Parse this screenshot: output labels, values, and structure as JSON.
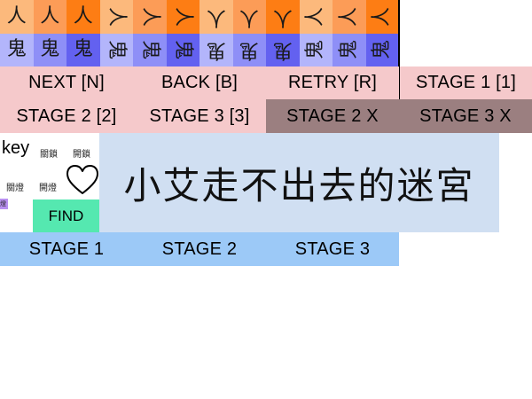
{
  "tile_rows": [
    {
      "glyphs": [
        "人",
        "人",
        "人",
        "人",
        "人",
        "人",
        "人",
        "人",
        "人",
        "人",
        "人",
        "人"
      ],
      "rotation_deg": [
        0,
        0,
        0,
        90,
        90,
        90,
        180,
        180,
        180,
        270,
        270,
        270
      ],
      "colors": [
        "#fcb97c",
        "#fc9c57",
        "#fd7d14",
        "#fcb97c",
        "#fc9c57",
        "#fd7d14",
        "#fcb97c",
        "#fc9c57",
        "#fd7d14",
        "#fcb97c",
        "#fc9c57",
        "#fd7d14"
      ]
    },
    {
      "glyphs": [
        "鬼",
        "鬼",
        "鬼",
        "鬼",
        "鬼",
        "鬼",
        "鬼",
        "鬼",
        "鬼",
        "鬼",
        "鬼",
        "鬼"
      ],
      "rotation_deg": [
        0,
        0,
        0,
        90,
        90,
        90,
        180,
        180,
        180,
        270,
        270,
        270
      ],
      "colors": [
        "#b3b5fb",
        "#8e8ff7",
        "#6361f0",
        "#b3b5fb",
        "#8e8ff7",
        "#6361f0",
        "#b3b5fb",
        "#8e8ff7",
        "#6361f0",
        "#b3b5fb",
        "#8e8ff7",
        "#6361f0"
      ]
    }
  ],
  "controls": {
    "next": "NEXT [N]",
    "back": "BACK [B]",
    "retry": "RETRY [R]",
    "stage1_key": "STAGE 1 [1]",
    "stage2_key": "STAGE 2 [2]",
    "stage3_key": "STAGE 3 [3]",
    "stage2_x": "STAGE 2 X",
    "stage3_x": "STAGE 3 X"
  },
  "panel": {
    "key_label": "key",
    "lock_a": "關鎖",
    "lock_b": "開鎖",
    "light_a": "關燈",
    "light_b": "開燈",
    "find_label": "FIND",
    "purple_mark": "燈",
    "heart_icon": "heart-icon"
  },
  "title": "小艾走不出去的迷宮",
  "stage_tabs": [
    "STAGE 1",
    "STAGE 2",
    "STAGE 3"
  ],
  "colors": {
    "pink": "#f5c9cb",
    "mauve": "#9b7f80",
    "blue": "#9cc9f7",
    "title_bg": "#d0dff2",
    "find_green": "#55e8b0"
  }
}
